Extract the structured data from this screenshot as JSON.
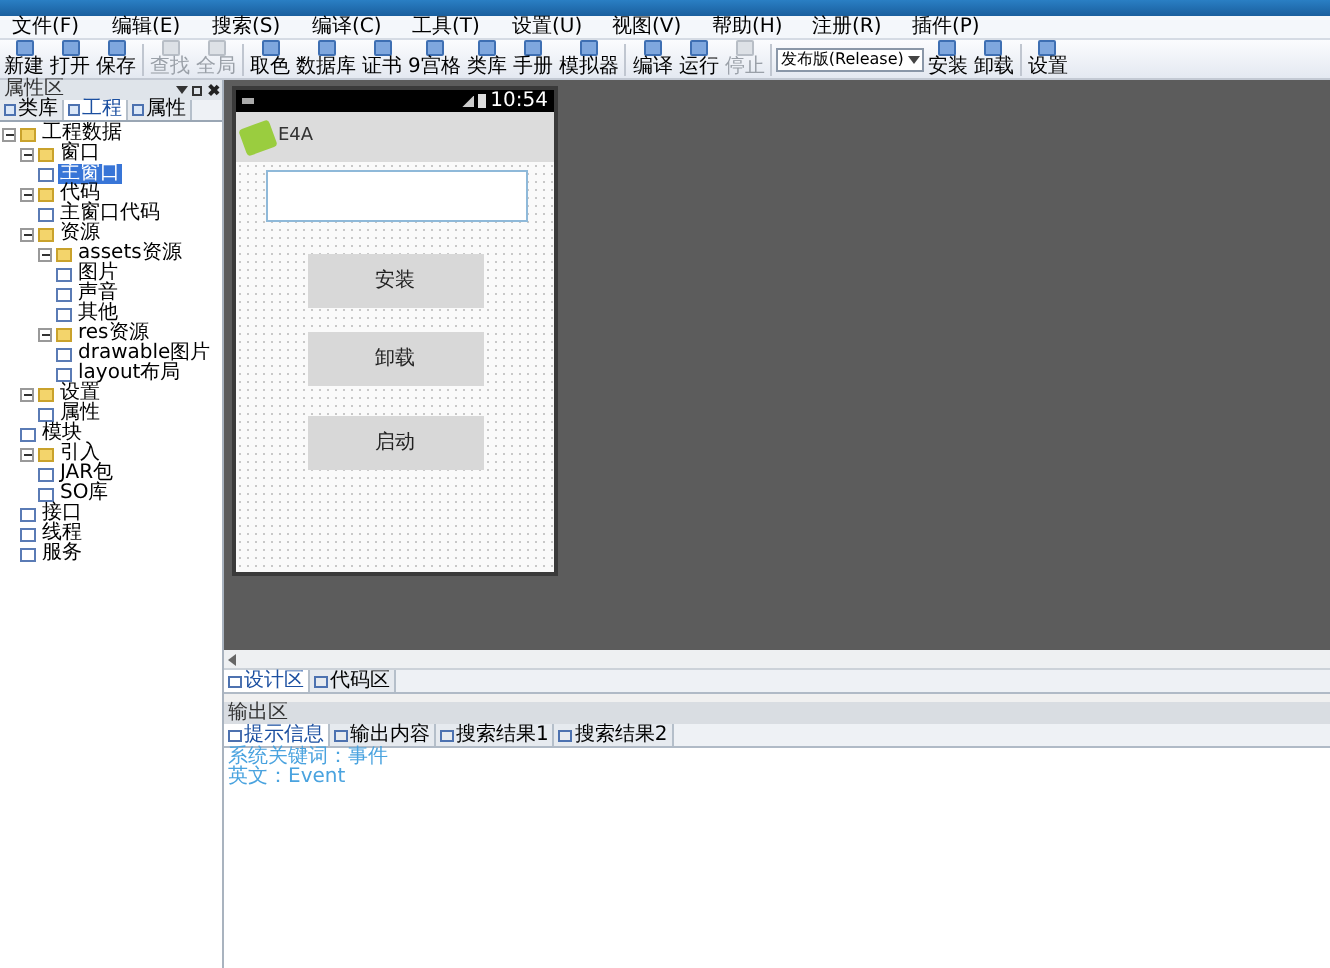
{
  "menu": [
    "文件(F)",
    "编辑(E)",
    "搜索(S)",
    "编译(C)",
    "工具(T)",
    "设置(U)",
    "视图(V)",
    "帮助(H)",
    "注册(R)",
    "插件(P)"
  ],
  "toolbar": [
    {
      "kind": "button",
      "label": "新建",
      "disabled": false
    },
    {
      "kind": "button",
      "label": "打开",
      "disabled": false
    },
    {
      "kind": "button",
      "label": "保存",
      "disabled": false
    },
    {
      "kind": "separator"
    },
    {
      "kind": "button",
      "label": "查找",
      "disabled": true
    },
    {
      "kind": "button",
      "label": "全局",
      "disabled": true
    },
    {
      "kind": "separator"
    },
    {
      "kind": "button",
      "label": "取色",
      "disabled": false
    },
    {
      "kind": "button",
      "label": "数据库",
      "disabled": false
    },
    {
      "kind": "button",
      "label": "证书",
      "disabled": false
    },
    {
      "kind": "button",
      "label": "9宫格",
      "disabled": false
    },
    {
      "kind": "button",
      "label": "类库",
      "disabled": false
    },
    {
      "kind": "button",
      "label": "手册",
      "disabled": false
    },
    {
      "kind": "button",
      "label": "模拟器",
      "disabled": false
    },
    {
      "kind": "separator"
    },
    {
      "kind": "button",
      "label": "编译",
      "disabled": false
    },
    {
      "kind": "button",
      "label": "运行",
      "disabled": false
    },
    {
      "kind": "button",
      "label": "停止",
      "disabled": true
    },
    {
      "kind": "separator"
    },
    {
      "kind": "dropdown",
      "value": "发布版(Release)"
    },
    {
      "kind": "button",
      "label": "安装",
      "disabled": false
    },
    {
      "kind": "button",
      "label": "卸载",
      "disabled": false
    },
    {
      "kind": "separator"
    },
    {
      "kind": "button",
      "label": "设置",
      "disabled": false
    }
  ],
  "left_panel": {
    "title": "属性区",
    "tabs": [
      {
        "label": "类库",
        "selected": false
      },
      {
        "label": "工程",
        "selected": true
      },
      {
        "label": "属性",
        "selected": false
      }
    ],
    "tree": [
      {
        "label": "工程数据",
        "selected": false,
        "expanded": true,
        "children": [
          {
            "label": "窗口",
            "selected": false,
            "expanded": true,
            "children": [
              {
                "label": "主窗口",
                "selected": true
              }
            ]
          },
          {
            "label": "代码",
            "selected": false,
            "expanded": true,
            "children": [
              {
                "label": "主窗口代码",
                "selected": false
              }
            ]
          },
          {
            "label": "资源",
            "selected": false,
            "expanded": true,
            "children": [
              {
                "label": "assets资源",
                "selected": false,
                "expanded": true,
                "children": [
                  {
                    "label": "图片",
                    "selected": false
                  },
                  {
                    "label": "声音",
                    "selected": false
                  },
                  {
                    "label": "其他",
                    "selected": false
                  }
                ]
              },
              {
                "label": "res资源",
                "selected": false,
                "expanded": true,
                "children": [
                  {
                    "label": "drawable图片",
                    "selected": false
                  },
                  {
                    "label": "layout布局",
                    "selected": false
                  }
                ]
              }
            ]
          },
          {
            "label": "设置",
            "selected": false,
            "expanded": true,
            "children": [
              {
                "label": "属性",
                "selected": false
              }
            ]
          },
          {
            "label": "模块",
            "selected": false
          },
          {
            "label": "引入",
            "selected": false,
            "expanded": true,
            "children": [
              {
                "label": "JAR包",
                "selected": false
              },
              {
                "label": "SO库",
                "selected": false
              }
            ]
          },
          {
            "label": "接口",
            "selected": false
          },
          {
            "label": "线程",
            "selected": false
          },
          {
            "label": "服务",
            "selected": false
          }
        ]
      }
    ]
  },
  "phone": {
    "time": "10:54",
    "app_title": "E4A",
    "buttons": [
      "安装",
      "卸载",
      "启动"
    ]
  },
  "editor_tabs": [
    {
      "label": "设计区",
      "selected": true
    },
    {
      "label": "代码区",
      "selected": false
    }
  ],
  "output": {
    "title": "输出区",
    "tabs": [
      {
        "label": "提示信息",
        "selected": true
      },
      {
        "label": "输出内容",
        "selected": false
      },
      {
        "label": "搜索结果1",
        "selected": false
      },
      {
        "label": "搜索结果2",
        "selected": false
      }
    ],
    "lines": [
      "系统关键词：事件",
      "英文：Event"
    ]
  }
}
